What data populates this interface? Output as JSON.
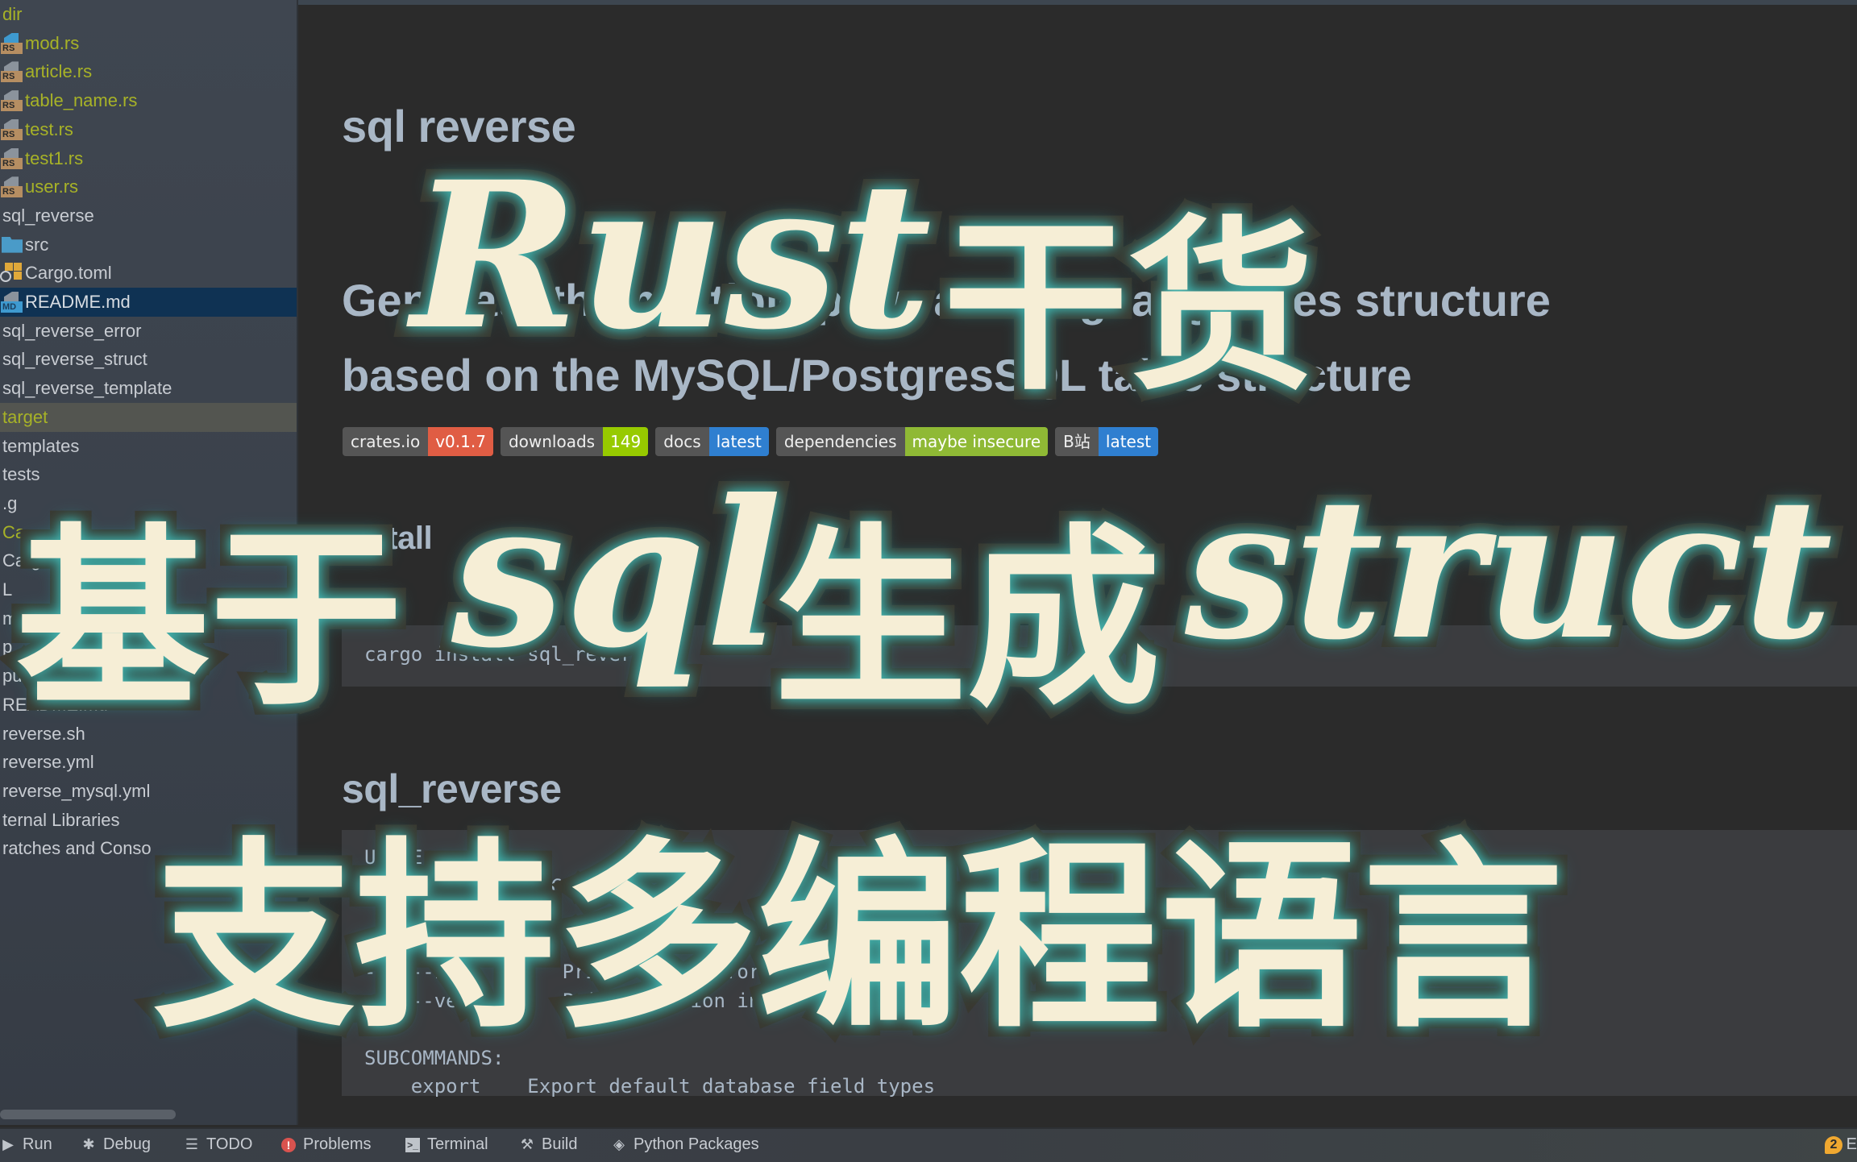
{
  "sidebar": {
    "items": [
      {
        "label": "dir",
        "kind": "text",
        "color": "yellow"
      },
      {
        "label": "mod.rs",
        "kind": "rs-file",
        "color": "yellow",
        "icon": "rust-file-icon",
        "page": "blue"
      },
      {
        "label": "article.rs",
        "kind": "rs-file",
        "color": "yellow",
        "icon": "rust-file-icon"
      },
      {
        "label": "table_name.rs",
        "kind": "rs-file",
        "color": "yellow",
        "icon": "rust-file-icon"
      },
      {
        "label": "test.rs",
        "kind": "rs-file",
        "color": "yellow",
        "icon": "rust-file-icon"
      },
      {
        "label": "test1.rs",
        "kind": "rs-file",
        "color": "yellow",
        "icon": "rust-file-icon"
      },
      {
        "label": "user.rs",
        "kind": "rs-file",
        "color": "yellow",
        "icon": "rust-file-icon"
      },
      {
        "label": "sql_reverse",
        "kind": "text"
      },
      {
        "label": "src",
        "kind": "folder",
        "icon": "folder-icon"
      },
      {
        "label": "Cargo.toml",
        "kind": "cargo",
        "icon": "cargo-file-icon"
      },
      {
        "label": "README.md",
        "kind": "md-file",
        "icon": "markdown-file-icon",
        "selected": true
      },
      {
        "label": "sql_reverse_error",
        "kind": "text"
      },
      {
        "label": "sql_reverse_struct",
        "kind": "text"
      },
      {
        "label": "sql_reverse_template",
        "kind": "text"
      },
      {
        "label": "target",
        "kind": "text",
        "color": "yellow",
        "hover": true
      },
      {
        "label": "templates",
        "kind": "text"
      },
      {
        "label": "tests",
        "kind": "text"
      },
      {
        "label": ".g",
        "kind": "text"
      },
      {
        "label": "Ca",
        "kind": "text",
        "color": "yellow"
      },
      {
        "label": "Cargo",
        "kind": "text"
      },
      {
        "label": "L",
        "kind": "text"
      },
      {
        "label": "m",
        "kind": "text"
      },
      {
        "label": "p",
        "kind": "text"
      },
      {
        "label": "pu",
        "kind": "text"
      },
      {
        "label": "README.md",
        "kind": "text"
      },
      {
        "label": "reverse.sh",
        "kind": "text"
      },
      {
        "label": "reverse.yml",
        "kind": "text"
      },
      {
        "label": "reverse_mysql.yml",
        "kind": "text"
      },
      {
        "label": "ternal Libraries",
        "kind": "text"
      },
      {
        "label": "ratches and Conso",
        "kind": "text"
      }
    ]
  },
  "editor": {
    "title": "sql reverse",
    "description_line1": "Generate the multiple programming languages structure",
    "description_line2": "based on the MySQL/PostgresSQL table structure",
    "badges": [
      {
        "key": "crates.io",
        "value": "v0.1.7",
        "color": "#e05d44"
      },
      {
        "key": "downloads",
        "value": "149",
        "color": "#97ca00"
      },
      {
        "key": "docs",
        "value": "latest",
        "color": "#2f7fd0"
      },
      {
        "key": "dependencies",
        "value": "maybe insecure",
        "color": "#8fb935"
      },
      {
        "key": "B站",
        "value": "latest",
        "color": "#2f7fd0"
      }
    ],
    "install_heading": "install",
    "install_command": "cargo install sql_reverse",
    "section_heading": "sql_reverse",
    "usage_lines": [
      "USAGE:",
      "sql_reverse <SUBCOMMAND>",
      "",
      "FLAGS:",
      "-h, --help       Prints help information",
      "-V, --version    Prints version information",
      "",
      "SUBCOMMANDS:",
      "    export    Export default database field types"
    ]
  },
  "overlay": {
    "line1_script": "Rust",
    "line1_cjk": "干货",
    "line2_cjk_a": "基于",
    "line2_script": "sql",
    "line2_cjk_b": "生成",
    "line2_script_b": "struct",
    "line3_cjk": "支持多编程语言",
    "text_color": "#f6eed6",
    "stroke_color": "#3a3830",
    "glow_color": "#47b5b0"
  },
  "bottom_bar": {
    "tools": [
      {
        "label": "Run",
        "icon": "run-icon"
      },
      {
        "label": "Debug",
        "icon": "debug-icon"
      },
      {
        "label": "TODO",
        "icon": "todo-list-icon"
      },
      {
        "label": "Problems",
        "icon": "problems-icon"
      },
      {
        "label": "Terminal",
        "icon": "terminal-icon"
      },
      {
        "label": "Build",
        "icon": "build-hammer-icon"
      },
      {
        "label": "Python Packages",
        "icon": "python-packages-icon"
      }
    ],
    "event_log_count": "2",
    "event_log_label": "E"
  }
}
